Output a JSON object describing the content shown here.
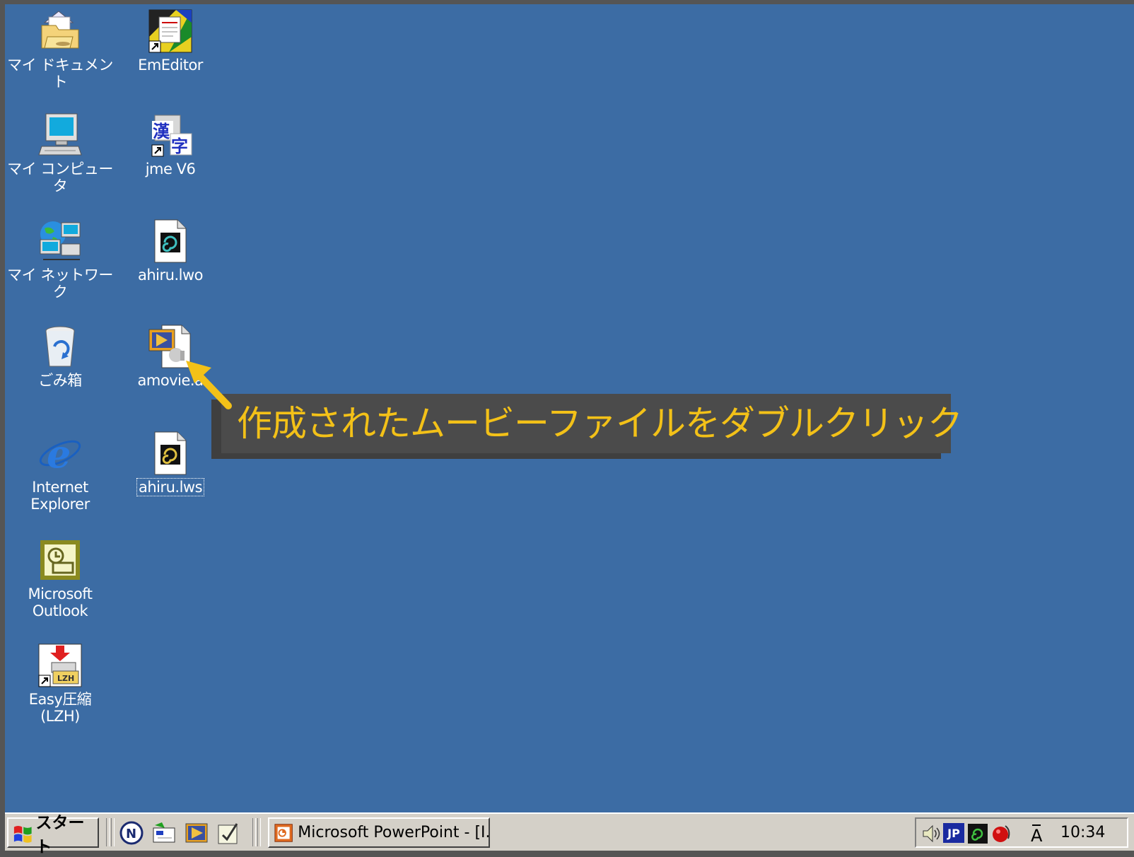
{
  "desktop": {
    "icons": [
      {
        "label": "マイ ドキュメント",
        "icon": "my-documents-icon"
      },
      {
        "label": "EmEditor",
        "icon": "emeditor-icon"
      },
      {
        "label": "マイ コンピュータ",
        "icon": "my-computer-icon"
      },
      {
        "label": "jme V6",
        "icon": "jme-icon"
      },
      {
        "label": "マイ ネットワーク",
        "icon": "network-icon"
      },
      {
        "label": "ahiru.lwo",
        "icon": "lwo-file-icon"
      },
      {
        "label": "ごみ箱",
        "icon": "recycle-bin-icon"
      },
      {
        "label": "amovie.a",
        "icon": "movie-file-icon"
      },
      {
        "label": "Internet\nExplorer",
        "icon": "internet-explorer-icon"
      },
      {
        "label": "ahiru.lws",
        "icon": "lws-file-icon"
      },
      {
        "label": "Microsoft\nOutlook",
        "icon": "outlook-icon"
      },
      {
        "label": "Easy圧縮\n(LZH)",
        "icon": "easy-compress-icon"
      }
    ]
  },
  "callout": {
    "text": "作成されたムービーファイルをダブルクリック",
    "text_color": "#f3c118",
    "background": "#4b4b4b"
  },
  "taskbar": {
    "start_label": "スタート",
    "quick_launch": [
      "netscape-icon",
      "outlook-express-icon",
      "media-player-icon",
      "show-desktop-icon"
    ],
    "tasks": [
      {
        "label": "Microsoft PowerPoint - [I...",
        "icon": "powerpoint-icon"
      }
    ],
    "tray": {
      "icons": [
        "volume-icon",
        "ime-jp-icon",
        "lightwave-icon",
        "antivirus-icon",
        "ime-input-icon"
      ],
      "ime_label": "JP",
      "clock": "10:34"
    }
  },
  "colors": {
    "desktop": "#3c6ca4",
    "taskbar": "#d4d0c8",
    "callout_text": "#f3c118"
  }
}
